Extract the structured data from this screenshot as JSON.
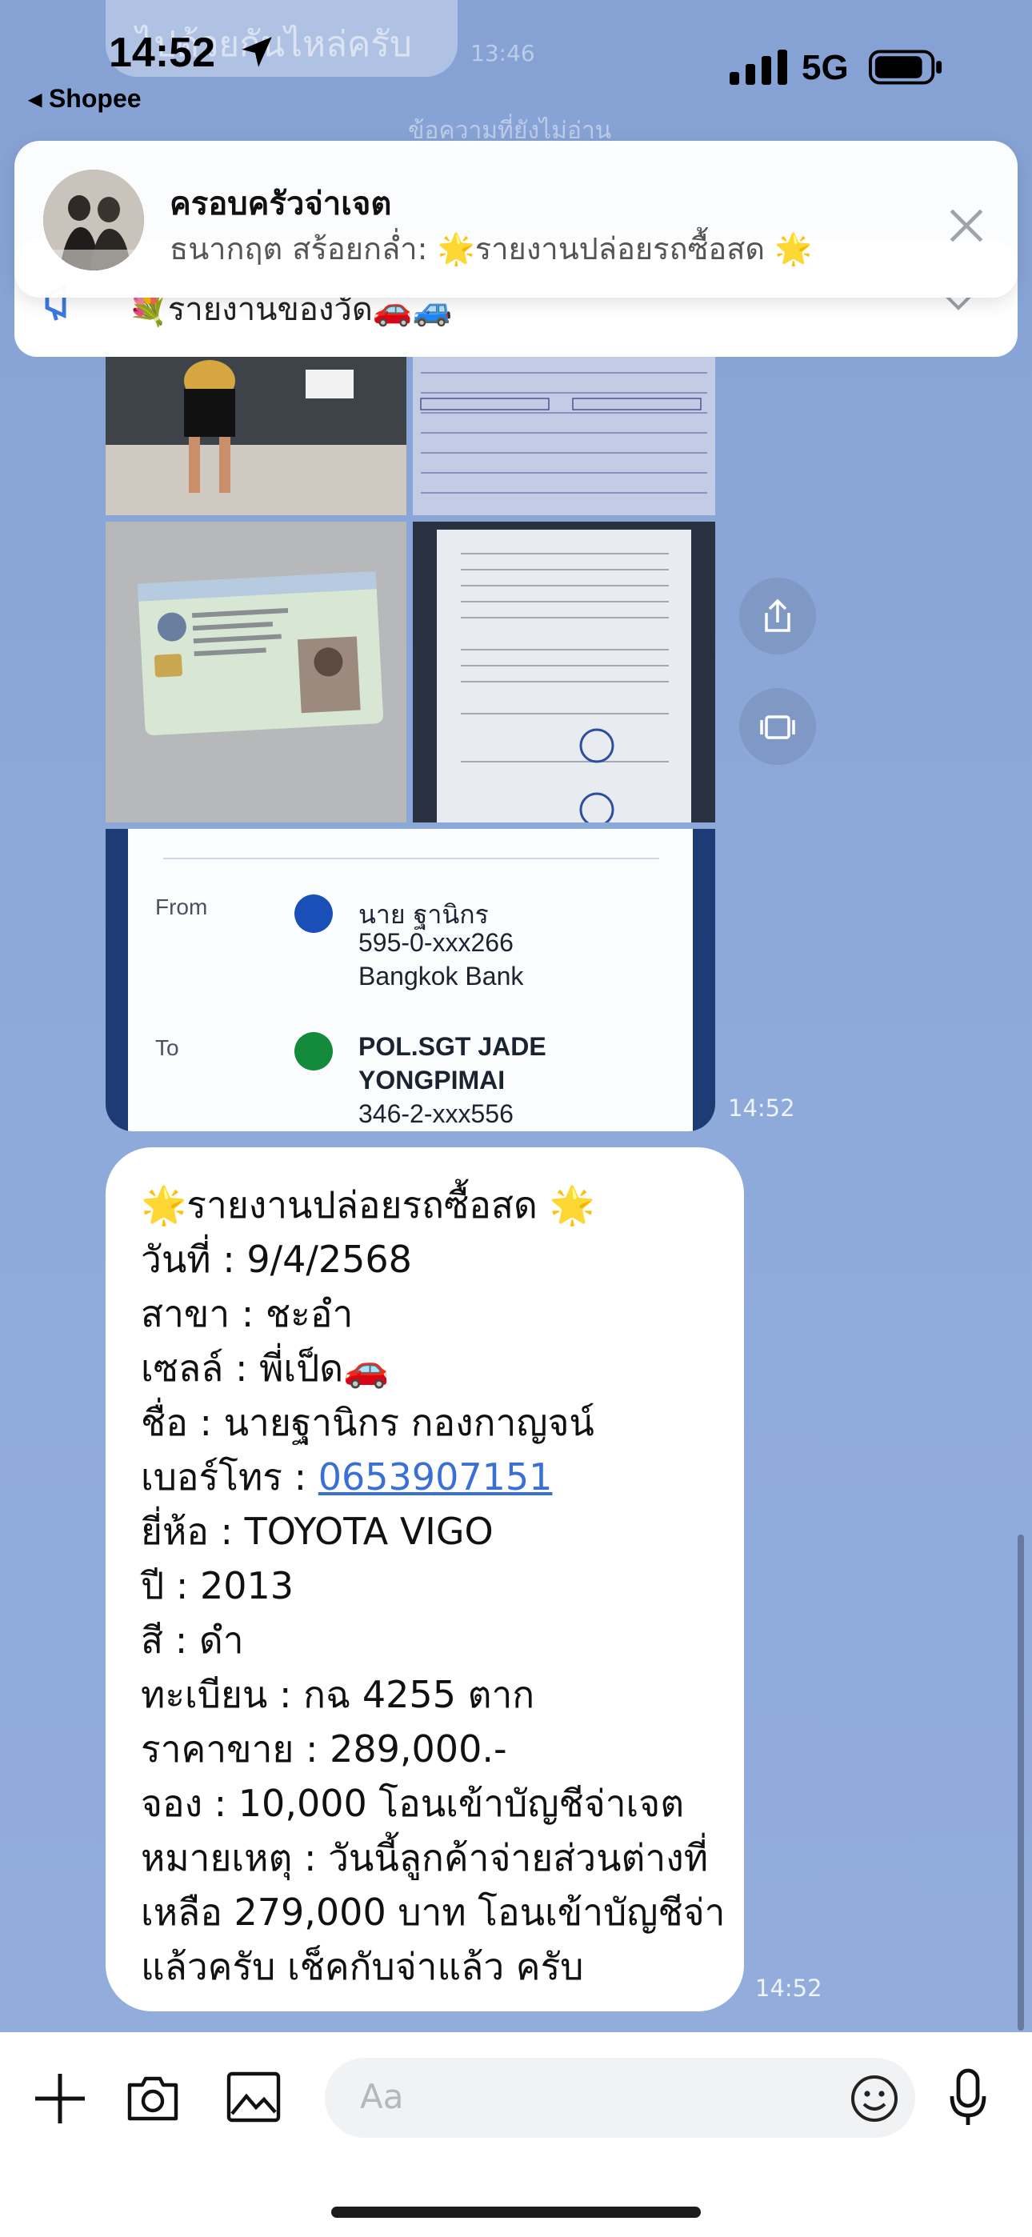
{
  "status_bar": {
    "time": "14:52",
    "back_app": "◂ Shopee",
    "network": "5G"
  },
  "background_chat": {
    "previous_message": "ไปด้วยกันไหล่ครับ",
    "previous_time": "13:46",
    "unread_label": "ข้อความที่ยังไม่อ่าน"
  },
  "notification": {
    "title": "ครอบครัวจ่าเจต",
    "body": "ธนากฤต สร้อยกล่ำ: 🌟รายงานปล่อยรถซื้อสด 🌟"
  },
  "pinned": {
    "text": "💐รายงานของวัด🚗🚙"
  },
  "image_message": {
    "time": "14:52",
    "bank": {
      "from_label": "From",
      "from_name": "นาย ฐานิกร",
      "from_account": "595-0-xxx266",
      "from_bank": "Bangkok Bank",
      "to_label": "To",
      "to_name_1": "POL.SGT JADE",
      "to_name_2": "YONGPIMAI",
      "to_account": "346-2-xxx556"
    }
  },
  "text_message": {
    "time": "14:52",
    "lines": [
      "🌟รายงานปล่อยรถซื้อสด 🌟",
      "วันที่ : 9/4/2568",
      "สาขา : ชะอำ",
      "เซลล์ : พี่เป็ด🚗",
      "ชื่อ : นายฐานิกร กองกาญจน์",
      "เบอร์โทร : ",
      "ยี่ห้อ : TOYOTA VIGO",
      "ปี : 2013",
      "สี : ดำ",
      "ทะเบียน : กฉ 4255 ตาก",
      "ราคาขาย : 289,000.-",
      "จอง : 10,000 โอนเข้าบัญชีจ่าเจต",
      "หมายเหตุ : วันนี้ลูกค้าจ่ายส่วนต่างที่",
      "เหลือ 279,000 บาท โอนเข้าบัญชีจ่า",
      "แล้วครับ เช็คกับจ่าแล้ว ครับ"
    ],
    "phone": "0653907151"
  },
  "input_bar": {
    "placeholder": "Aa"
  },
  "colors": {
    "chat_background": "#8ba6d6",
    "link": "#3b6fd8"
  }
}
